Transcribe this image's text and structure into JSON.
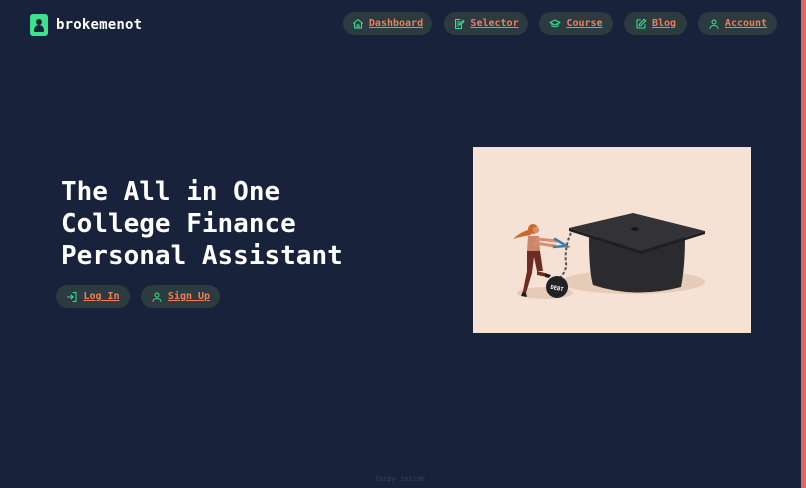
{
  "brand": {
    "name": "brokemenot",
    "accent": "#3ee08e"
  },
  "nav": {
    "items": [
      {
        "label": "Dashboard",
        "icon": "home-icon"
      },
      {
        "label": "Selector",
        "icon": "edit-list-icon"
      },
      {
        "label": "Course",
        "icon": "graduation-cap-icon"
      },
      {
        "label": "Blog",
        "icon": "pencil-square-icon"
      },
      {
        "label": "Account",
        "icon": "user-icon"
      }
    ]
  },
  "hero": {
    "title_lines": [
      "The All in One",
      "College Finance",
      "Personal Assistant"
    ],
    "illustration_text": "DEBT"
  },
  "actions": {
    "login": {
      "label": "Log In",
      "icon": "login-icon"
    },
    "signup": {
      "label": "Sign Up",
      "icon": "user-icon"
    }
  },
  "footer": {
    "note": "Taipy inside"
  },
  "colors": {
    "background": "#18223a",
    "pill": "#2b3b3f",
    "link": "#f07e5c",
    "icon": "#3ee08e",
    "edge": "#e0685a",
    "illustration_bg": "#f5e2d4"
  }
}
